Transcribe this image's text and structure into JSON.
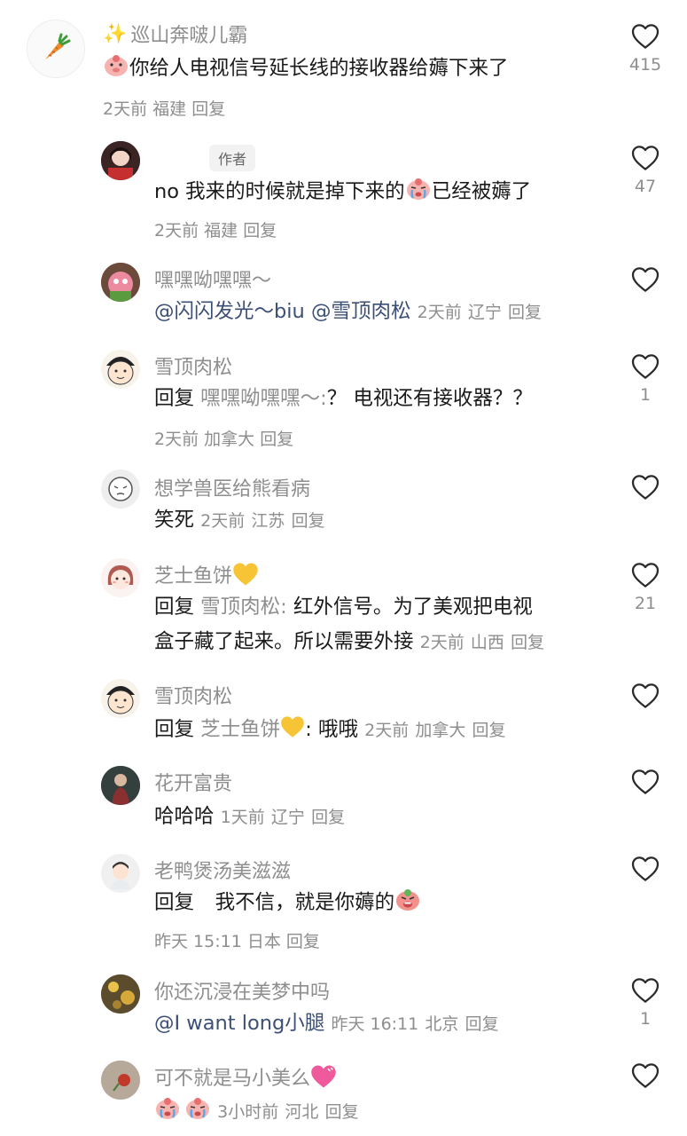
{
  "colors": {
    "text_primary": "#1a1a1a",
    "text_secondary": "#8e8e8e",
    "mention": "#3c4f76",
    "badge_bg": "#f2f2f2",
    "sparkle": "#f5c43c",
    "carrot": "#f08a2c",
    "yellow_heart": "#f7c436",
    "pink_heart": "#e8458a"
  },
  "comments": [
    {
      "avatar_icon": "carrot-icon",
      "username": "巡山奔啵儿霸",
      "text": "你给人电视信号延长线的接收器给薅下来了",
      "time": "2天前",
      "location": "福建",
      "reply": "回复",
      "likes": "415"
    },
    {
      "username": "",
      "author_badge": "作者",
      "text_before": "no 我来的时候就是掉下来的",
      "text_after": "已经被薅了",
      "time": "2天前",
      "location": "福建",
      "reply": "回复",
      "likes": "47"
    },
    {
      "username": "嘿嘿呦嘿嘿～",
      "mention1": "@闪闪发光～biu",
      "mention2": "@雪顶肉松",
      "time": "2天前",
      "location": "辽宁",
      "reply": "回复",
      "likes": ""
    },
    {
      "username": "雪顶肉松",
      "reply_prefix": "回复",
      "reply_to": "嘿嘿呦嘿嘿～:",
      "text": "？ 电视还有接收器？？",
      "time": "2天前",
      "location": "加拿大",
      "reply": "回复",
      "likes": "1"
    },
    {
      "username": "想学兽医给熊看病",
      "text": "笑死",
      "time": "2天前",
      "location": "江苏",
      "reply": "回复",
      "likes": ""
    },
    {
      "username": "芝士鱼饼",
      "reply_prefix": "回复",
      "reply_to": "雪顶肉松:",
      "text_line1": "红外信号。为了美观把电视",
      "text_line2": "盒子藏了起来。所以需要外接",
      "time": "2天前",
      "location": "山西",
      "reply": "回复",
      "likes": "21"
    },
    {
      "username": "雪顶肉松",
      "reply_prefix": "回复",
      "reply_to": "芝士鱼饼",
      "reply_to_suffix": ":",
      "text": "哦哦",
      "time": "2天前",
      "location": "加拿大",
      "reply": "回复",
      "likes": ""
    },
    {
      "username": "花开富贵",
      "text": "哈哈哈",
      "time": "1天前",
      "location": "辽宁",
      "reply": "回复",
      "likes": ""
    },
    {
      "username": "老鸭煲汤美滋滋",
      "reply_prefix": "回复",
      "text": "⠀我不信，就是你薅的",
      "time": "昨天 15:11",
      "location": "日本",
      "reply": "回复",
      "likes": ""
    },
    {
      "username": "你还沉浸在美梦中吗",
      "mention1": "@I want long小腿",
      "time": "昨天 16:11",
      "location": "北京",
      "reply": "回复",
      "likes": "1"
    },
    {
      "username": "可不就是马小美么",
      "time": "3小时前",
      "location": "河北",
      "reply": "回复",
      "likes": ""
    }
  ]
}
